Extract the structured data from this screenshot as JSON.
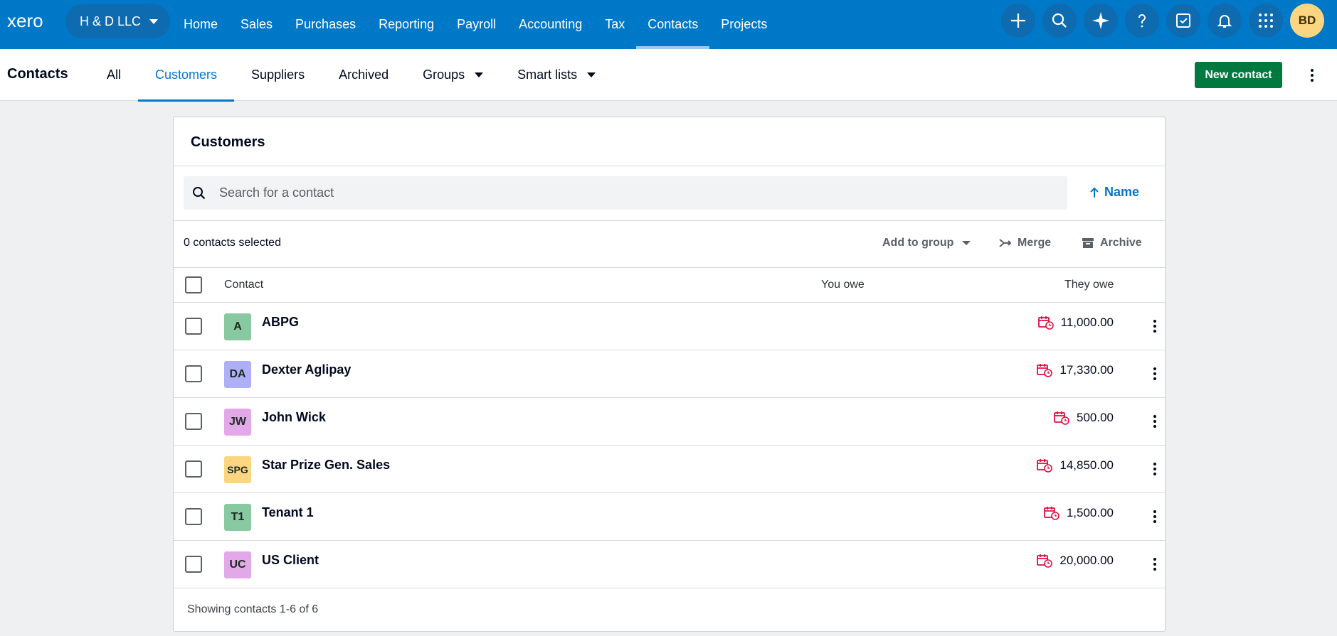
{
  "brand": {
    "logo": "xero",
    "org_name": "H & D LLC",
    "primary": "#0078c8",
    "accent_green": "#00793e"
  },
  "topnav": {
    "links": [
      "Home",
      "Sales",
      "Purchases",
      "Reporting",
      "Payroll",
      "Accounting",
      "Tax",
      "Contacts",
      "Projects"
    ],
    "active": "Contacts",
    "icons": [
      "plus-icon",
      "search-icon",
      "sparkle-icon",
      "help-icon",
      "task-icon",
      "bell-icon",
      "apps-grid-icon"
    ],
    "user_initials": "BD"
  },
  "subnav": {
    "title": "Contacts",
    "tabs": [
      "All",
      "Customers",
      "Suppliers",
      "Archived",
      "Groups",
      "Smart lists"
    ],
    "active": "Customers",
    "new_button": "New contact"
  },
  "card": {
    "title": "Customers",
    "search_placeholder": "Search for a contact",
    "sort_label": "Name",
    "selected_text": "0 contacts selected",
    "actions": {
      "add_to_group": "Add to group",
      "merge": "Merge",
      "archive": "Archive"
    },
    "columns": {
      "contact": "Contact",
      "you_owe": "You owe",
      "they_owe": "They owe"
    },
    "rows": [
      {
        "initials": "A",
        "name": "ABPG",
        "they_owe": "11,000.00",
        "color": "#88c9a1"
      },
      {
        "initials": "DA",
        "name": "Dexter Aglipay",
        "they_owe": "17,330.00",
        "color": "#aeaff5"
      },
      {
        "initials": "JW",
        "name": "John Wick",
        "they_owe": "500.00",
        "color": "#e3a8e8"
      },
      {
        "initials": "SPG",
        "name": "Star Prize Gen. Sales",
        "they_owe": "14,850.00",
        "color": "#fcd581"
      },
      {
        "initials": "T1",
        "name": "Tenant 1",
        "they_owe": "1,500.00",
        "color": "#88c9a1"
      },
      {
        "initials": "UC",
        "name": "US Client",
        "they_owe": "20,000.00",
        "color": "#e3a8e8"
      }
    ],
    "footer": "Showing contacts 1-6 of 6"
  }
}
